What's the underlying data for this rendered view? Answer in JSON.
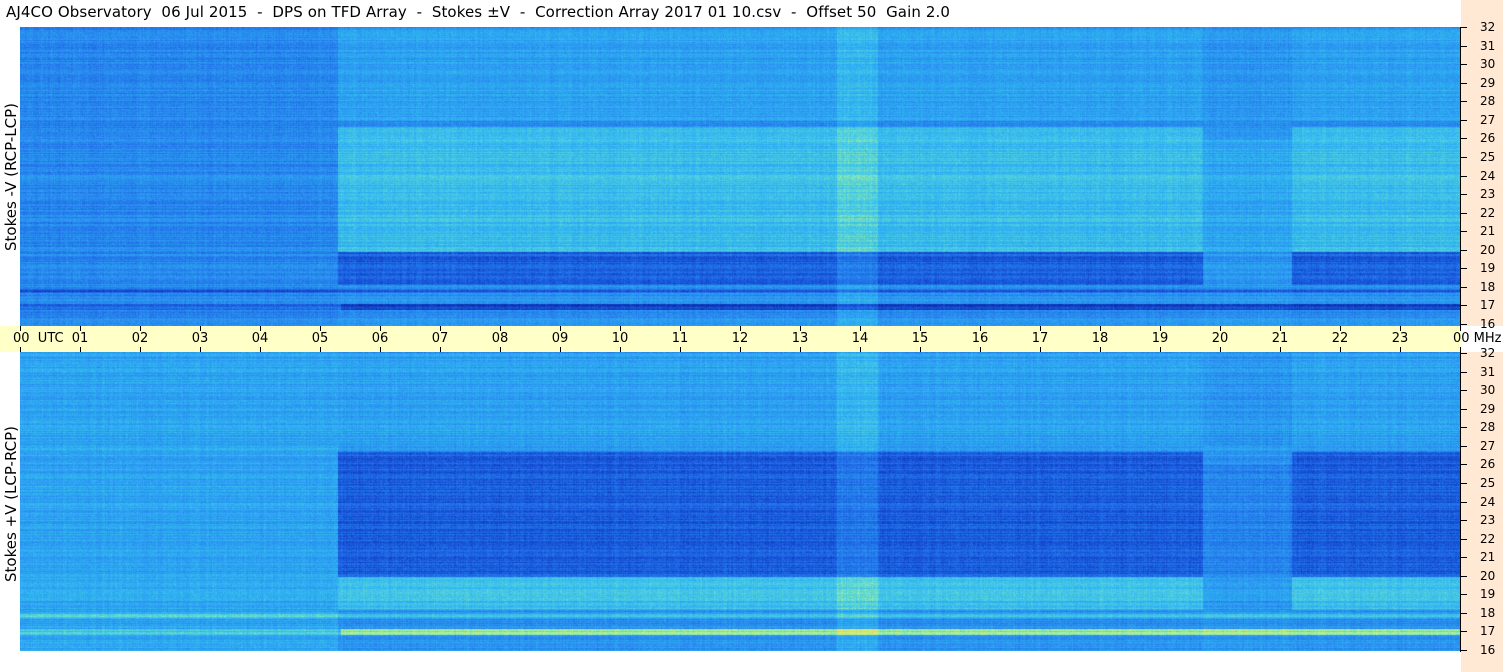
{
  "title": "AJ4CO Observatory  06 Jul 2015  -  DPS on TFD Array  -  Stokes ±V  -  Correction Array 2017 01 10.csv  -  Offset 50  Gain 2.0",
  "chart_data": [
    {
      "type": "heatmap",
      "ylabel": "Stokes -V (RCP-LCP)",
      "y_unit": "MHz",
      "ylim": [
        16,
        32
      ],
      "y_ticks": [
        "16",
        "17",
        "18",
        "19",
        "20",
        "21",
        "22",
        "23",
        "24",
        "25",
        "26",
        "27",
        "28",
        "29",
        "30",
        "31",
        "32"
      ],
      "x_ticks": [
        "00  UTC",
        "01",
        "02",
        "03",
        "04",
        "05",
        "06",
        "07",
        "08",
        "09",
        "10",
        "11",
        "12",
        "13",
        "14",
        "15",
        "16",
        "17",
        "18",
        "19",
        "20",
        "21",
        "22",
        "23",
        "00 MHz"
      ],
      "xlim_hours": [
        0,
        24
      ],
      "colormap": [
        "#0a1f8f",
        "#1040c8",
        "#1f6ae6",
        "#2a90f0",
        "#2fb2f2",
        "#4fd0e0",
        "#9ef0a0",
        "#f0e860",
        "#f0a040"
      ]
    },
    {
      "type": "heatmap",
      "ylabel": "Stokes +V (LCP-RCP)",
      "y_unit": "MHz",
      "ylim": [
        16,
        32
      ],
      "y_ticks": [
        "16",
        "17",
        "18",
        "19",
        "20",
        "21",
        "22",
        "23",
        "24",
        "25",
        "26",
        "27",
        "28",
        "29",
        "30",
        "31",
        "32"
      ],
      "xlim_hours": [
        0,
        24
      ],
      "colormap": [
        "#0a1f8f",
        "#1040c8",
        "#1f6ae6",
        "#2a90f0",
        "#2fb2f2",
        "#4fd0e0",
        "#9ef0a0",
        "#f0e860",
        "#f0a040"
      ]
    }
  ]
}
